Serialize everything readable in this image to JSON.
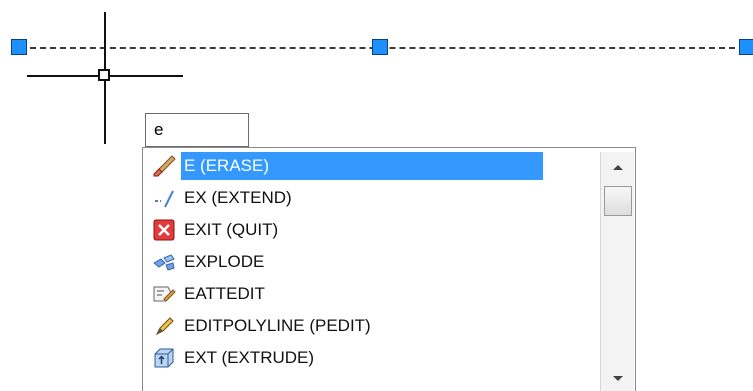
{
  "command_input": {
    "value": "e"
  },
  "suggestions": [
    {
      "label": "E (ERASE)",
      "icon": "erase-icon",
      "selected": true
    },
    {
      "label": "EX (EXTEND)",
      "icon": "extend-icon",
      "selected": false
    },
    {
      "label": "EXIT (QUIT)",
      "icon": "quit-icon",
      "selected": false
    },
    {
      "label": "EXPLODE",
      "icon": "explode-icon",
      "selected": false
    },
    {
      "label": "EATTEDIT",
      "icon": "eattedit-icon",
      "selected": false
    },
    {
      "label": "EDITPOLYLINE (PEDIT)",
      "icon": "pedit-icon",
      "selected": false
    },
    {
      "label": "EXT (EXTRUDE)",
      "icon": "extrude-icon",
      "selected": false
    }
  ],
  "colors": {
    "selection": "#3399ff",
    "grip": "#1e90ff"
  }
}
